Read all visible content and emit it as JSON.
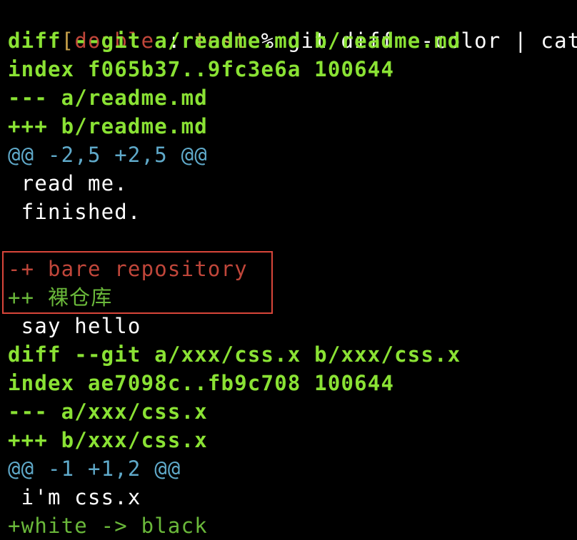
{
  "prompt": {
    "bracket": "[",
    "user": "double",
    "sep": " : ",
    "dir": "test",
    "symbol": " % ",
    "command": "git diff --color | cat"
  },
  "diff": [
    {
      "kind": "header",
      "text": "diff --git a/readme.md b/readme.md"
    },
    {
      "kind": "header",
      "text": "index f065b37..9fc3e6a 100644"
    },
    {
      "kind": "header",
      "text": "--- a/readme.md"
    },
    {
      "kind": "header",
      "text": "+++ b/readme.md"
    },
    {
      "kind": "hunk",
      "text": "@@ -2,5 +2,5 @@"
    },
    {
      "kind": "ctx",
      "text": " read me."
    },
    {
      "kind": "ctx",
      "text": " finished."
    },
    {
      "kind": "ctx",
      "text": ""
    },
    {
      "kind": "removed",
      "text": "-+ bare repository"
    },
    {
      "kind": "added",
      "text": "++ 裸仓库"
    },
    {
      "kind": "ctx",
      "text": " say hello"
    },
    {
      "kind": "header",
      "text": "diff --git a/xxx/css.x b/xxx/css.x"
    },
    {
      "kind": "header",
      "text": "index ae7098c..fb9c708 100644"
    },
    {
      "kind": "header",
      "text": "--- a/xxx/css.x"
    },
    {
      "kind": "header",
      "text": "+++ b/xxx/css.x"
    },
    {
      "kind": "hunk",
      "text": "@@ -1 +1,2 @@"
    },
    {
      "kind": "ctx",
      "text": " i'm css.x"
    },
    {
      "kind": "added",
      "text": "+white -> black"
    }
  ],
  "colors": {
    "background": "#000000",
    "header": "#8ae234",
    "hunk": "#5fa9c9",
    "removed": "#c0463a",
    "added": "#6ab83a",
    "highlight_box": "#d9463a"
  }
}
